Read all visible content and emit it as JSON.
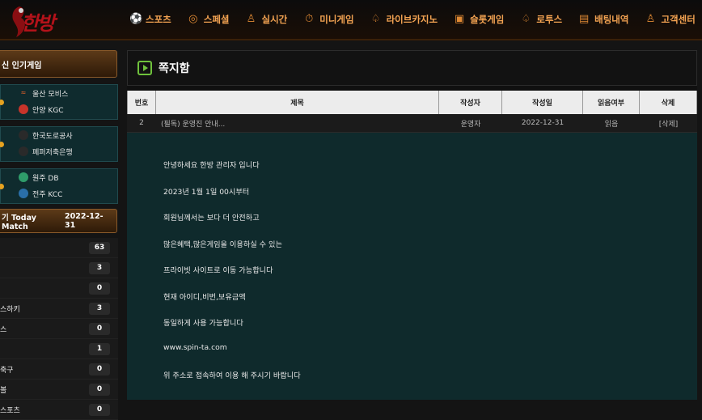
{
  "logo": {
    "text": "한방"
  },
  "nav": [
    {
      "icon": "sports-icon",
      "glyph": "⚽",
      "label": "스포츠"
    },
    {
      "icon": "basketball-icon",
      "glyph": "◎",
      "label": "스페셜"
    },
    {
      "icon": "person-icon",
      "glyph": "♙",
      "label": "실시간"
    },
    {
      "icon": "stopwatch-icon",
      "glyph": "⏱",
      "label": "미니게임"
    },
    {
      "icon": "spade-icon",
      "glyph": "♤",
      "label": "라이브카지노"
    },
    {
      "icon": "slot-icon",
      "glyph": "▣",
      "label": "슬롯게임"
    },
    {
      "icon": "spade-icon",
      "glyph": "♤",
      "label": "로투스"
    },
    {
      "icon": "list-icon",
      "glyph": "▤",
      "label": "배팅내역"
    },
    {
      "icon": "support-icon",
      "glyph": "♙",
      "label": "고객센터"
    }
  ],
  "sidebar": {
    "popular_title": "신 인기게임",
    "matches": [
      {
        "home": {
          "name": "울산 모비스",
          "color": "#e8622a"
        },
        "away": {
          "name": "안양 KGC",
          "color": "#c8342a"
        }
      },
      {
        "home": {
          "name": "한국도로공사",
          "color": "#333333"
        },
        "away": {
          "name": "페퍼저축은행",
          "color": "#333333"
        }
      },
      {
        "home": {
          "name": "원주 DB",
          "color": "#2f9c6a"
        },
        "away": {
          "name": "전주 KCC",
          "color": "#2a6fa8"
        }
      }
    ],
    "today_title": "기 Today Match",
    "today_date": "2022-12-31",
    "counts": [
      {
        "label": "",
        "value": "63"
      },
      {
        "label": "",
        "value": "3"
      },
      {
        "label": "",
        "value": "0"
      },
      {
        "label": "스하키",
        "value": "3"
      },
      {
        "label": "스",
        "value": "0"
      },
      {
        "label": "",
        "value": "1"
      },
      {
        "label": "축구",
        "value": "0"
      },
      {
        "label": "볼",
        "value": "0"
      },
      {
        "label": "스포츠",
        "value": "0"
      }
    ]
  },
  "main": {
    "title": "쪽지함",
    "headers": [
      "번호",
      "제목",
      "작성자",
      "작성일",
      "읽음여부",
      "삭제"
    ],
    "row": {
      "no": "2",
      "subject": "(필독) 운영진 안내...",
      "author": "운영자",
      "date": "2022-12-31",
      "read": "읽음",
      "delete": "[삭제]"
    },
    "message_lines": [
      "안녕하세요 한방 관리자 입니다",
      "2023년 1월 1일 00시부터",
      "회원님께서는 보다 더 안전하고",
      "많은혜택,많은게임을 이용하실 수 있는",
      "프라이빗 사이트로 이동 가능합니다",
      "현재 아이디,비번,보유금액",
      "동일하게 사용 가능합니다",
      "www.spin-ta.com",
      "위 주소로 접속하여 이용 해 주시기 바랍니다"
    ]
  }
}
